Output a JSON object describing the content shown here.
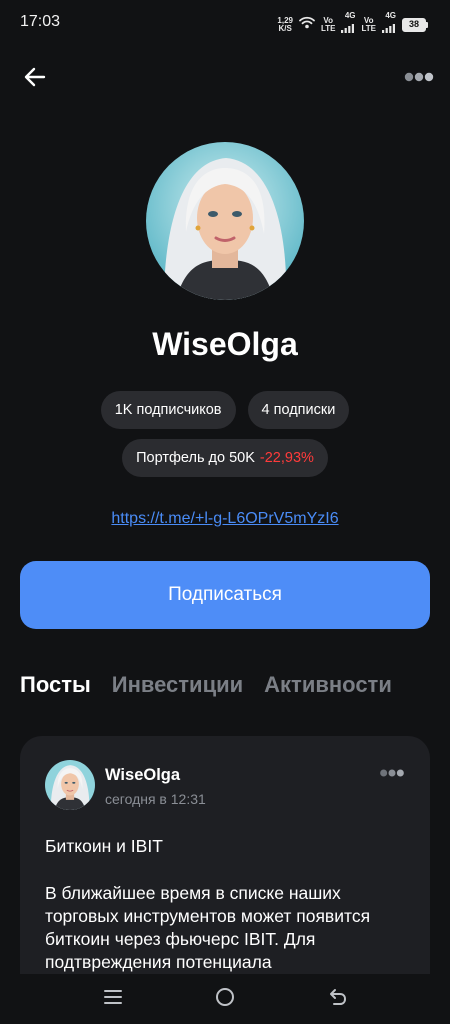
{
  "status_bar": {
    "time": "17:03",
    "net_speed_value": "1,29",
    "net_speed_unit": "K/S",
    "sim1_label_top": "Vo",
    "sim1_label_bottom": "LTE",
    "sim1_network": "4G",
    "sim2_label_top": "Vo",
    "sim2_label_bottom": "LTE",
    "sim2_network": "4G",
    "battery_level": "38",
    "icons": [
      "wifi-icon",
      "signal-icon",
      "signal-icon",
      "battery-icon"
    ]
  },
  "header": {
    "back_icon": "arrow-left-icon",
    "more_icon": "more-dots-icon"
  },
  "profile": {
    "name": "WiseOlga",
    "followers": "1K подписчиков",
    "following": "4 подписки",
    "portfolio_label": "Портфель до 50K",
    "portfolio_change": "-22,93%",
    "link": "https://t.me/+l-g-L6OPrV5mYzI6",
    "subscribe_label": "Подписаться"
  },
  "tabs": [
    {
      "label": "Посты",
      "active": true
    },
    {
      "label": "Инвестиции",
      "active": false
    },
    {
      "label": "Активности",
      "active": false
    }
  ],
  "post": {
    "author": "WiseOlga",
    "time": "сегодня в 12:31",
    "title": "Биткоин и IBIT",
    "body": "В ближайшее время в списке наших торговых инструментов может появится биткоин через фьючерс IBIT. Для подтвреждения потенциала"
  },
  "nav": {
    "icons": [
      "menu-icon",
      "home-circle-icon",
      "back-nav-icon"
    ]
  },
  "colors": {
    "background": "#111214",
    "chip": "#2b2c30",
    "accent": "#4e8df7",
    "link": "#4a8cf7",
    "negative": "#ff3b3b",
    "card": "#1e1f23",
    "muted": "#7b7f86"
  }
}
